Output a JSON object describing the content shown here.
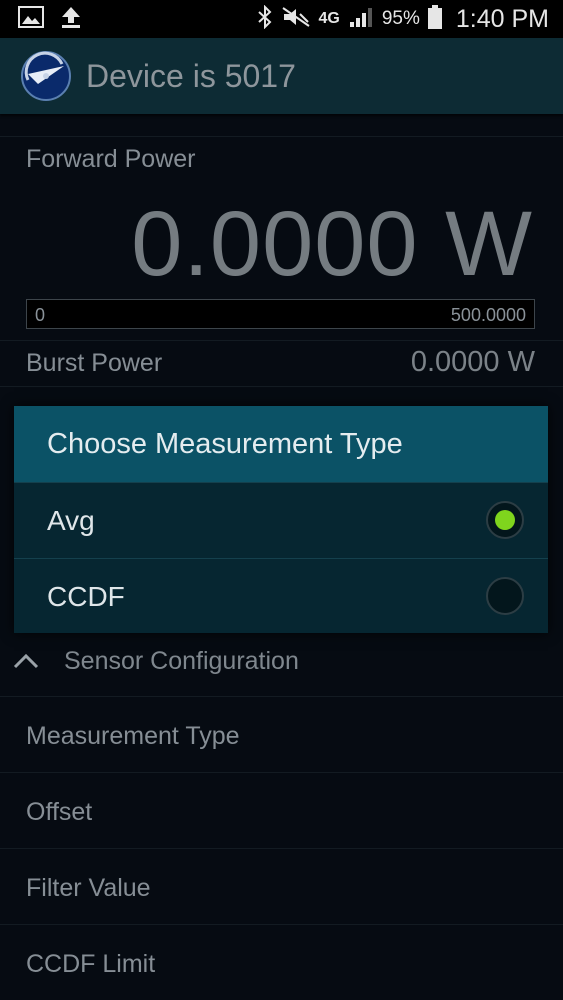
{
  "status_bar": {
    "battery_percent": "95%",
    "time": "1:40 PM",
    "network": "4G",
    "icons": [
      "gallery-icon",
      "upload-icon",
      "bluetooth-icon",
      "mute-icon",
      "4g-icon",
      "signal-icon",
      "battery-icon"
    ]
  },
  "action_bar": {
    "title": "Device is 5017",
    "logo": "gauge-logo-icon"
  },
  "forward_power": {
    "label": "Forward Power",
    "value": "0.0000 W",
    "bar_min": "0",
    "bar_max": "500.0000",
    "bar_fill_fraction": 0
  },
  "rows": {
    "burst_power": {
      "label": "Burst Power",
      "value": "0.0000 W"
    }
  },
  "sensor_section": {
    "label": "Sensor Configuration",
    "items": [
      "Measurement Type",
      "Offset",
      "Filter Value",
      "CCDF Limit"
    ]
  },
  "dialog": {
    "title": "Choose Measurement Type",
    "options": [
      {
        "label": "Avg",
        "selected": true
      },
      {
        "label": "CCDF",
        "selected": false
      }
    ],
    "accent_color": "#7fd51d"
  },
  "colors": {
    "header_bg": "#0d2b34",
    "dialog_title_bg": "#0b5266",
    "page_bg": "#060b12"
  }
}
